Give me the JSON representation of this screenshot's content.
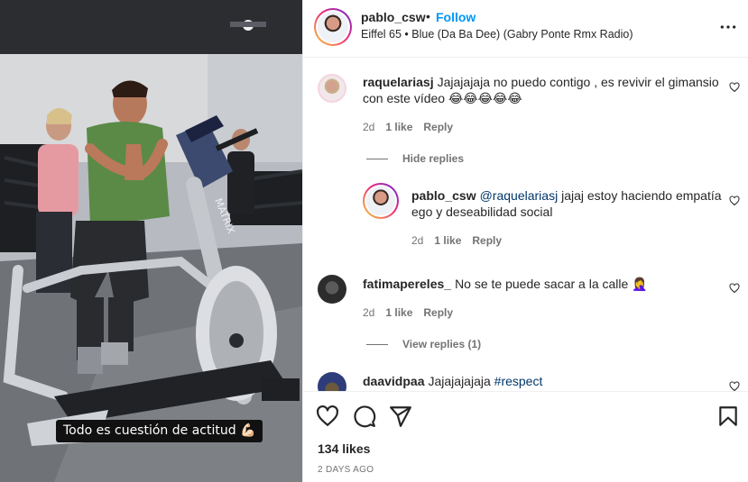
{
  "media": {
    "caption": "Todo es cuestión de actitud 💪🏻",
    "brand_text": "MATRIX"
  },
  "header": {
    "username": "pablo_csw",
    "dot": "•",
    "follow_label": "Follow",
    "audio": "Eiffel 65 • Blue (Da Ba Dee) (Gabry Ponte Rmx Radio)"
  },
  "comments": [
    {
      "username": "raquelariasj",
      "text": "Jajajajaja no puedo contigo , es revivir el gimansio con este vídeo 😂😂😂😂😂",
      "time": "2d",
      "likes": "1 like",
      "reply": "Reply",
      "toggle": "Hide replies",
      "replies": [
        {
          "username": "pablo_csw",
          "mention": "@raquelariasj",
          "text": " jajaj estoy haciendo empatía ego y deseabilidad social",
          "time": "2d",
          "likes": "1 like",
          "reply": "Reply"
        }
      ]
    },
    {
      "username": "fatimapereles_",
      "text": "No se te puede sacar a la calle 🤦‍♀️",
      "time": "2d",
      "likes": "1 like",
      "reply": "Reply",
      "toggle": "View replies (1)"
    },
    {
      "username": "daavidpaa",
      "text": "Jajajajajaja ",
      "hashtag": "#respect"
    }
  ],
  "footer": {
    "likes": "134 likes",
    "date": "2 DAYS AGO"
  },
  "colors": {
    "accent": "#0095f6",
    "text": "#262626",
    "muted": "#737373",
    "divider": "#efefef"
  },
  "icons": [
    "more-icon",
    "heart-icon",
    "comment-icon",
    "share-icon",
    "bookmark-icon"
  ]
}
